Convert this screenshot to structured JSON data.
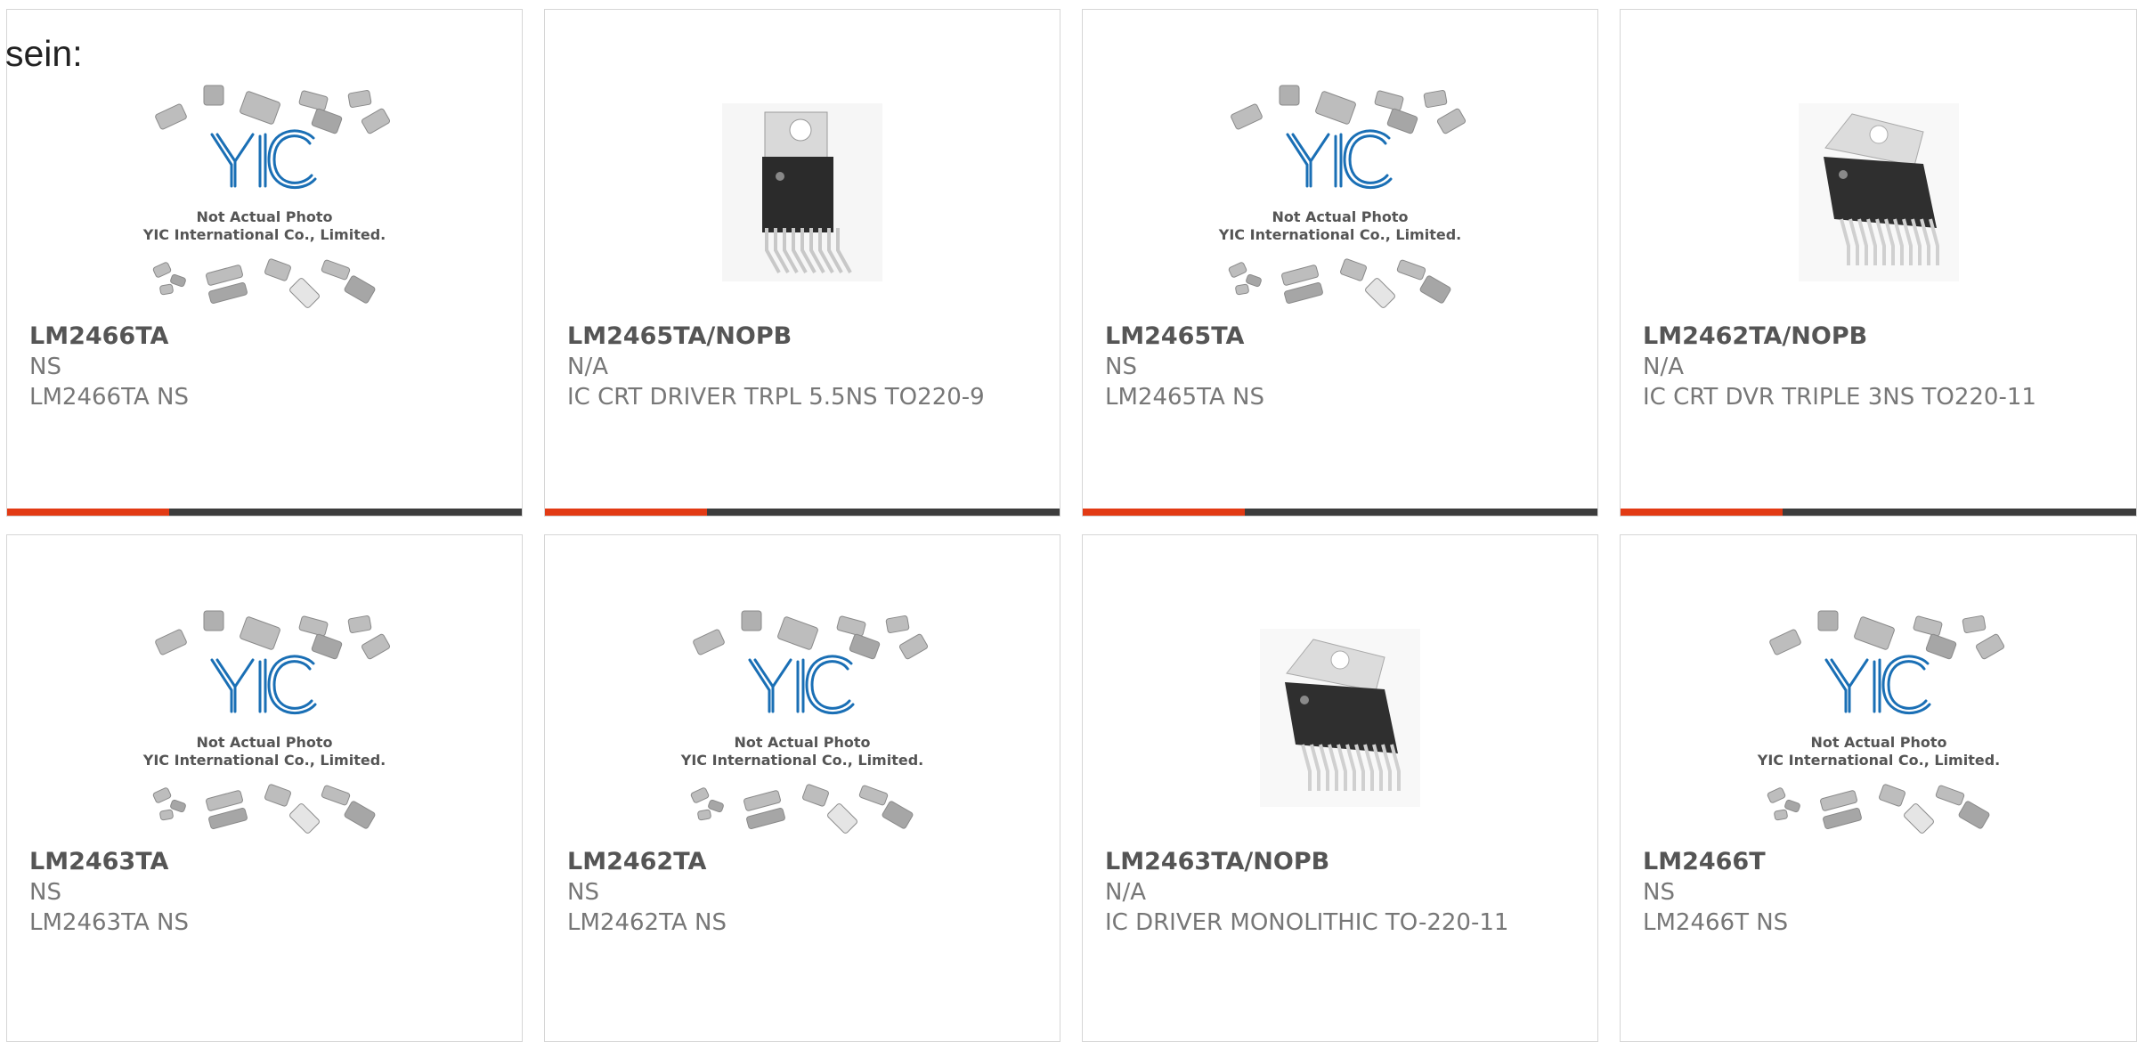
{
  "intro_text": "sein:",
  "placeholder": {
    "line1": "Not Actual Photo",
    "line2": "YIC International Co., Limited."
  },
  "colors": {
    "accent": "#e23a14",
    "bar": "#3c3c3c",
    "logo_blue": "#1a6fb5",
    "text": "#777777"
  },
  "products": [
    {
      "part": "LM2466TA",
      "manufacturer": "NS",
      "description": "LM2466TA NS",
      "image": "placeholder"
    },
    {
      "part": "LM2465TA/NOPB",
      "manufacturer": "N/A",
      "description": "IC CRT DRIVER TRPL 5.5NS TO220-9",
      "image": "to220-vertical"
    },
    {
      "part": "LM2465TA",
      "manufacturer": "NS",
      "description": "LM2465TA NS",
      "image": "placeholder"
    },
    {
      "part": "LM2462TA/NOPB",
      "manufacturer": "N/A",
      "description": "IC CRT DVR TRIPLE 3NS TO220-11",
      "image": "to220-angled"
    },
    {
      "part": "LM2463TA",
      "manufacturer": "NS",
      "description": "LM2463TA NS",
      "image": "placeholder"
    },
    {
      "part": "LM2462TA",
      "manufacturer": "NS",
      "description": "LM2462TA NS",
      "image": "placeholder"
    },
    {
      "part": "LM2463TA/NOPB",
      "manufacturer": "N/A",
      "description": "IC DRIVER MONOLITHIC TO-220-11",
      "image": "to220-angled"
    },
    {
      "part": "LM2466T",
      "manufacturer": "NS",
      "description": "LM2466T NS",
      "image": "placeholder"
    }
  ]
}
